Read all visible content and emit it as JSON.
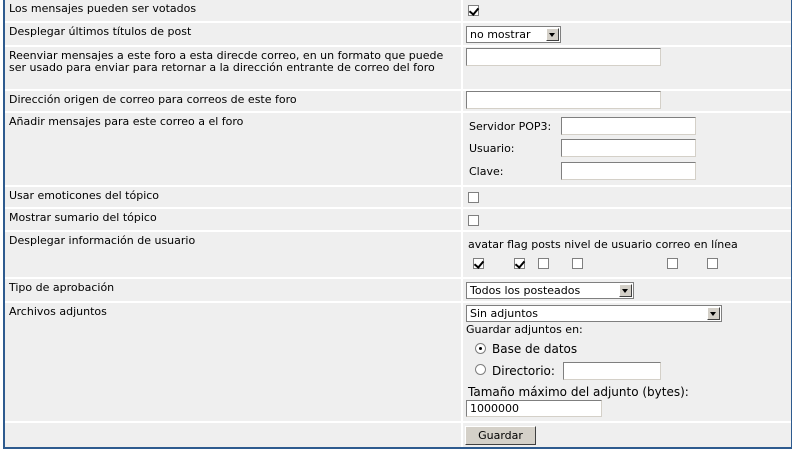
{
  "rows": {
    "voted": {
      "label": "Los mensajes pueden ser votados",
      "checked": true
    },
    "titles": {
      "label": "Desplegar últimos títulos de post",
      "select": "no mostrar"
    },
    "forward": {
      "label": "Reenviar mensajes a este foro a esta direcde correo, en un formato que puede ser usado para enviar para retornar a la dirección entrante de correo del foro",
      "value": ""
    },
    "origin": {
      "label": "Dirección origen de correo para correos de este foro",
      "value": ""
    },
    "pop": {
      "label": "Añadir mensajes para este correo a el foro",
      "server_label": "Servidor POP3:",
      "user_label": "Usuario:",
      "pass_label": "Clave:"
    },
    "emoticons": {
      "label": "Usar emoticones del tópico",
      "checked": false
    },
    "summary": {
      "label": "Mostrar sumario del tópico",
      "checked": false
    },
    "userinfo": {
      "label": "Desplegar información de usuario",
      "header": "avatar flag posts nivel de usuario correo en línea",
      "options": [
        {
          "name": "avatar",
          "checked": true
        },
        {
          "name": "flag",
          "checked": true
        },
        {
          "name": "posts",
          "checked": false
        },
        {
          "name": "nivel de usuario",
          "checked": false
        },
        {
          "name": "correo",
          "checked": false
        },
        {
          "name": "en línea",
          "checked": false
        }
      ]
    },
    "approval": {
      "label": "Tipo de aprobación",
      "select": "Todos los posteados"
    },
    "attachments": {
      "label": "Archivos adjuntos",
      "select": "Sin adjuntos",
      "save_in": "Guardar adjuntos en:",
      "db_label": "Base de datos",
      "dir_label": "Directorio:",
      "max_label": "Tamaño máximo del adjunto (bytes):",
      "max_value": "1000000"
    }
  },
  "save_button": "Guardar"
}
